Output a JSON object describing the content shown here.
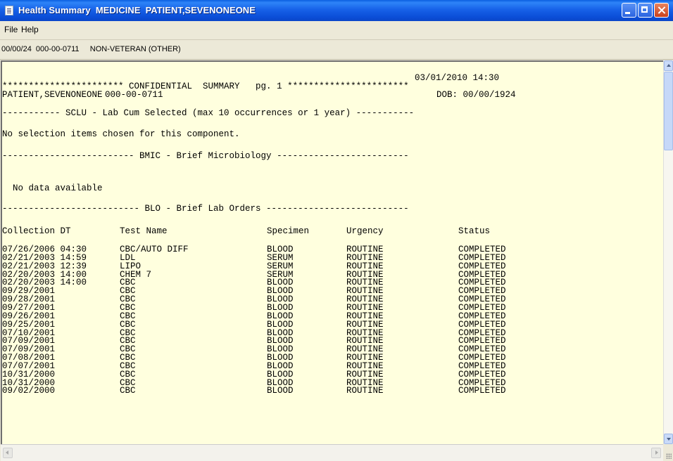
{
  "window": {
    "title": "Health Summary  MEDICINE  PATIENT,SEVENONEONE"
  },
  "menu": {
    "file": "File",
    "help": "Help"
  },
  "patient_bar": {
    "text": "00/00/24  000-00-0711     NON-VETERAN (OTHER)"
  },
  "report": {
    "datetime": "03/01/2010 14:30",
    "header_line": "*********************** CONFIDENTIAL  SUMMARY   pg. 1 ***********************",
    "patient_name": "PATIENT,SEVENONEONE",
    "ssn": "000-00-0711",
    "dob": "DOB: 00/00/1924",
    "sclu_header": "----------- SCLU - Lab Cum Selected (max 10 occurrences or 1 year) -----------",
    "sclu_message": "No selection items chosen for this component.",
    "bmic_header": "------------------------- BMIC - Brief Microbiology -------------------------",
    "bmic_message": "  No data available",
    "blo_header": "-------------------------- BLO - Brief Lab Orders ---------------------------",
    "columns": [
      "Collection DT",
      "Test Name",
      "Specimen",
      "Urgency",
      "Status"
    ],
    "rows": [
      [
        "07/26/2006 04:30",
        "CBC/AUTO DIFF",
        "BLOOD",
        "ROUTINE",
        "COMPLETED"
      ],
      [
        "02/21/2003 14:59",
        "LDL",
        "SERUM",
        "ROUTINE",
        "COMPLETED"
      ],
      [
        "02/21/2003 12:39",
        "LIPO",
        "SERUM",
        "ROUTINE",
        "COMPLETED"
      ],
      [
        "02/20/2003 14:00",
        "CHEM 7",
        "SERUM",
        "ROUTINE",
        "COMPLETED"
      ],
      [
        "02/20/2003 14:00",
        "CBC",
        "BLOOD",
        "ROUTINE",
        "COMPLETED"
      ],
      [
        "09/29/2001",
        "CBC",
        "BLOOD",
        "ROUTINE",
        "COMPLETED"
      ],
      [
        "09/28/2001",
        "CBC",
        "BLOOD",
        "ROUTINE",
        "COMPLETED"
      ],
      [
        "09/27/2001",
        "CBC",
        "BLOOD",
        "ROUTINE",
        "COMPLETED"
      ],
      [
        "09/26/2001",
        "CBC",
        "BLOOD",
        "ROUTINE",
        "COMPLETED"
      ],
      [
        "09/25/2001",
        "CBC",
        "BLOOD",
        "ROUTINE",
        "COMPLETED"
      ],
      [
        "07/10/2001",
        "CBC",
        "BLOOD",
        "ROUTINE",
        "COMPLETED"
      ],
      [
        "07/09/2001",
        "CBC",
        "BLOOD",
        "ROUTINE",
        "COMPLETED"
      ],
      [
        "07/09/2001",
        "CBC",
        "BLOOD",
        "ROUTINE",
        "COMPLETED"
      ],
      [
        "07/08/2001",
        "CBC",
        "BLOOD",
        "ROUTINE",
        "COMPLETED"
      ],
      [
        "07/07/2001",
        "CBC",
        "BLOOD",
        "ROUTINE",
        "COMPLETED"
      ],
      [
        "10/31/2000",
        "CBC",
        "BLOOD",
        "ROUTINE",
        "COMPLETED"
      ],
      [
        "10/31/2000",
        "CBC",
        "BLOOD",
        "ROUTINE",
        "COMPLETED"
      ],
      [
        "09/02/2000",
        "CBC",
        "BLOOD",
        "ROUTINE",
        "COMPLETED"
      ]
    ]
  }
}
